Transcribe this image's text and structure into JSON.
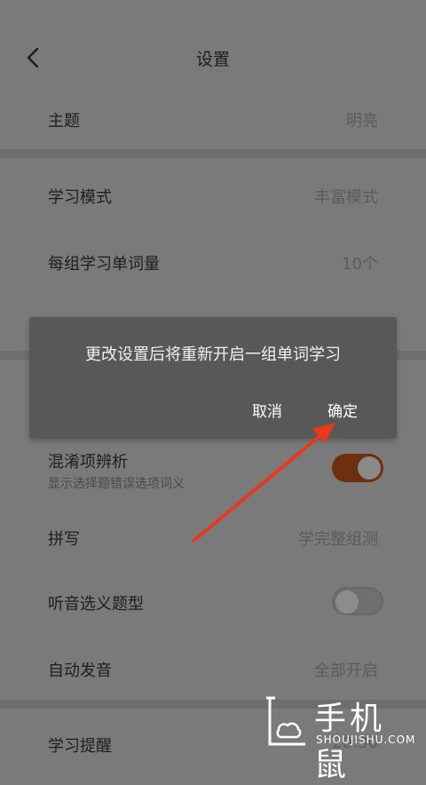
{
  "header": {
    "title": "设置"
  },
  "settings": {
    "theme": {
      "label": "主题",
      "value": "明亮"
    },
    "study_mode": {
      "label": "学习模式",
      "value": "丰富模式"
    },
    "words_per_group": {
      "label": "每组学习单词量",
      "value": "10个"
    },
    "confusion": {
      "label": "混淆项辨析",
      "sub": "显示选择题错误选项词义",
      "enabled": true
    },
    "spelling": {
      "label": "拼写",
      "value": "学完整组测"
    },
    "listening": {
      "label": "听音选义题型",
      "enabled": false
    },
    "auto_pronounce": {
      "label": "自动发音",
      "value": "全部开启"
    },
    "reminder": {
      "label": "学习提醒",
      "value": "20:30"
    }
  },
  "dialog": {
    "message": "更改设置后将重新开启一组单词学习",
    "cancel_label": "取消",
    "confirm_label": "确定"
  },
  "watermark": {
    "name": "手机鼠",
    "site": "SHOUJISHU.COM"
  },
  "colors": {
    "toggle_on": "#6e2e10",
    "annotation_arrow": "#e8391f"
  }
}
